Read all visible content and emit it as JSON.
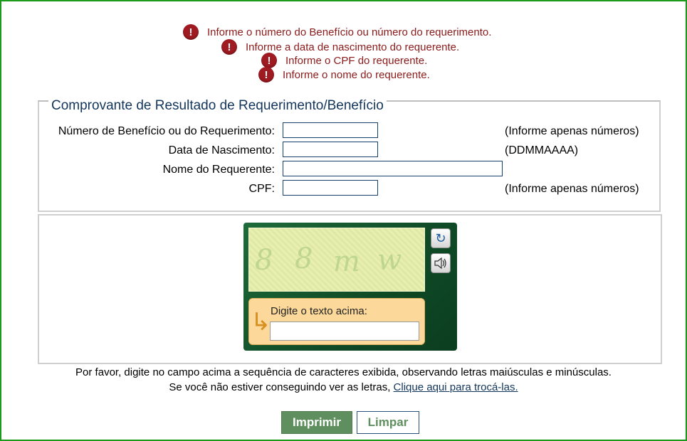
{
  "errors": [
    "Informe o número do Benefício ou número do requerimento.",
    "Informe a data de nascimento do requerente.",
    "Informe o CPF do requerente.",
    "Informe o nome do requerente."
  ],
  "error_icon": "!",
  "form": {
    "legend": "Comprovante de Resultado de Requerimento/Benefício",
    "fields": [
      {
        "label": "Número de Benefício ou do Requerimento:",
        "value": "",
        "hint": "(Informe apenas números)"
      },
      {
        "label": "Data de Nascimento:",
        "value": "",
        "hint": "(DDMMAAAA)"
      },
      {
        "label": "Nome do Requerente:",
        "value": "",
        "hint": ""
      },
      {
        "label": "CPF:",
        "value": "",
        "hint": "(Informe apenas números)"
      }
    ]
  },
  "captcha": {
    "prompt": "Digite o texto acima:",
    "value": "",
    "chars": [
      "8",
      "8",
      "m",
      "w"
    ],
    "refresh_icon": "refresh-icon",
    "audio_icon": "speaker-icon"
  },
  "note": {
    "line1": "Por favor, digite no campo acima a sequência de caracteres exibida, observando letras maiúsculas e minúsculas.",
    "line2_prefix": "Se você não estiver conseguindo ver as letras,",
    "line2_link": "Clique aqui para trocá-las."
  },
  "buttons": {
    "print": "Imprimir",
    "clear": "Limpar"
  },
  "colors": {
    "frame": "#1c9a1c",
    "error_text": "#8b1a1a",
    "legend_text": "#12355b",
    "primary_button": "#5f8f5e"
  }
}
